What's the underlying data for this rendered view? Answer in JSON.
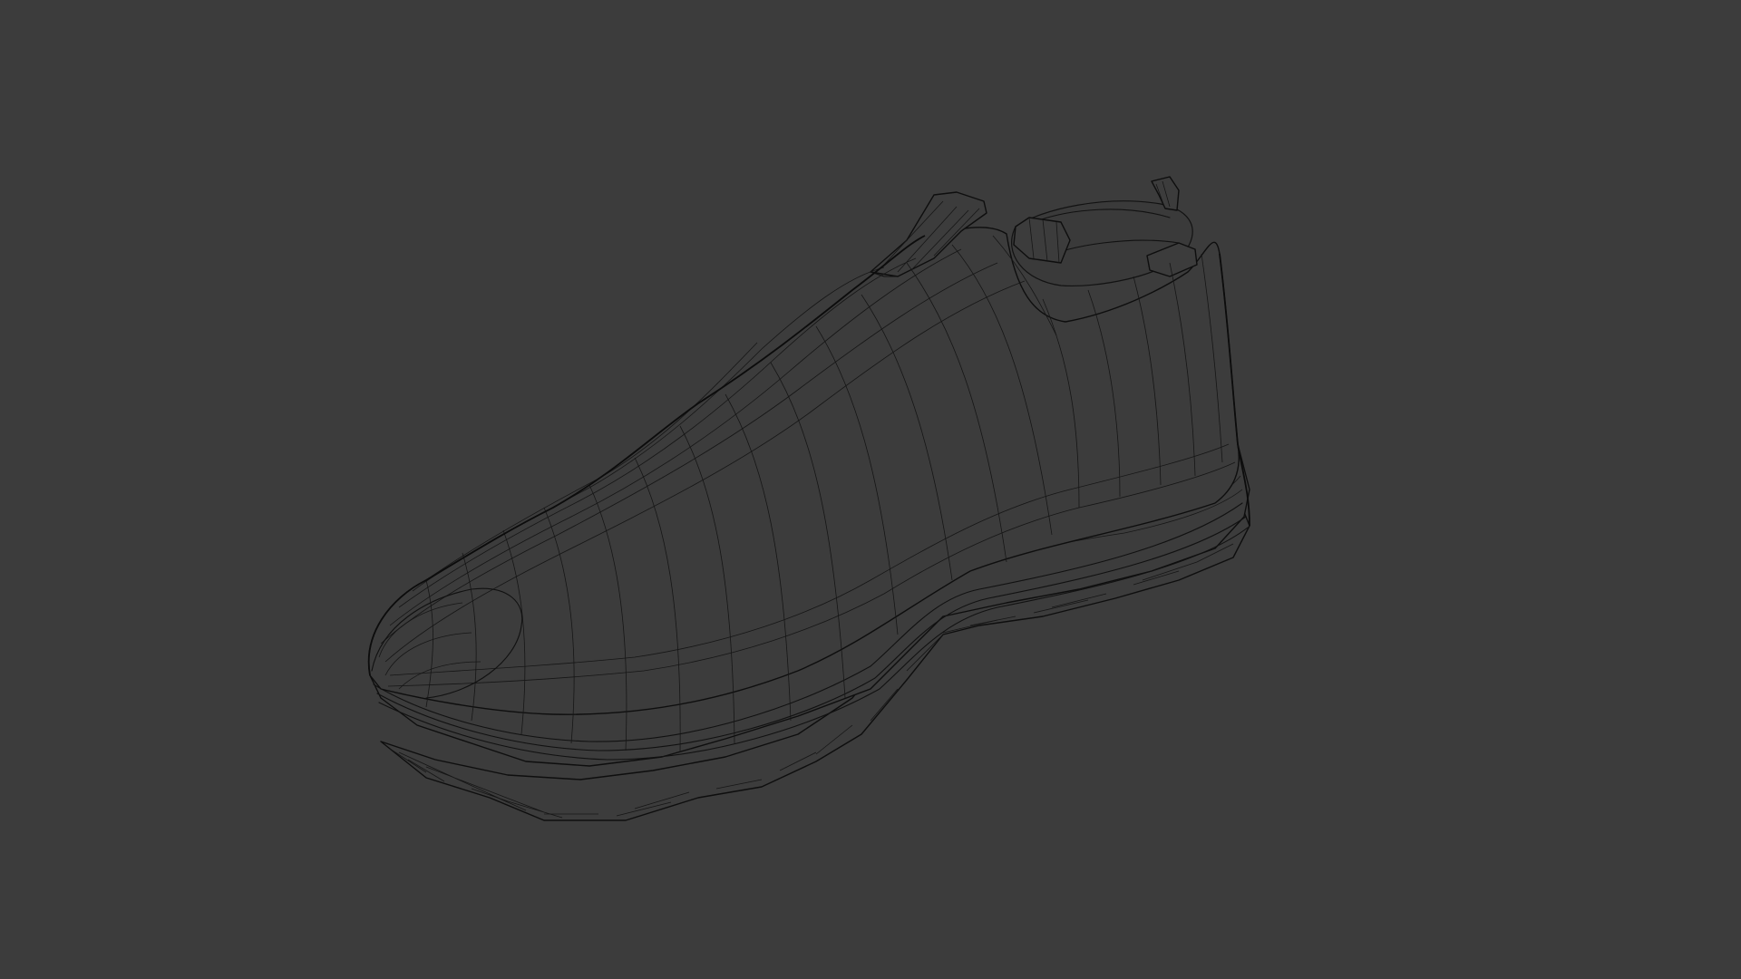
{
  "viewport": {
    "background_color": "#3c3c3c",
    "wire_color": "#111111",
    "object": "shoe-wireframe-mesh",
    "shading": "wireframe"
  }
}
